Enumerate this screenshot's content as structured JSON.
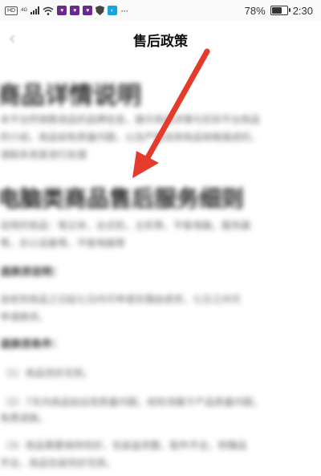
{
  "status_bar": {
    "hd_label": "HD",
    "network": "4G",
    "battery_percent": "78%",
    "battery_level": 0.78,
    "time": "2:30",
    "icons": [
      "signal-icon",
      "wifi-icon",
      "app-notification-icon",
      "app-notification-icon",
      "app-notification-icon",
      "shield-icon",
      "message-icon",
      "more-icon",
      "battery-icon"
    ]
  },
  "header": {
    "title": "售后政策",
    "back_label": "‹"
  },
  "content": {
    "heading_main": "商品详情说明",
    "heading_main_para": [
      "本平台所销售商品的品牌信息，展示商品详情与实际平台商品",
      "的介绍，商品如有质量问题，以及严重违背商品规格描述的，",
      "请联系商家进行处理"
    ],
    "heading_section": "电脑类商品售后服务细则",
    "section_para": [
      "适用的商品：笔记本，台式机，主机等，平板电脑，服务器",
      "等，办公设备等，平板电脑等"
    ],
    "subheading_1": "退换货说明：",
    "sub1_para": [
      "自收到商品之日起七日内可申请无理由退货，七日之内可",
      "申请换货。"
    ],
    "subheading_2": "退换货条件：",
    "list_items": [
      "（1）商品完好无损。",
      "（2）7天内商品如出现质量问题，经检测属于产品质量问题，",
      "      免费退换。",
      "（3）商品需要保持完好，包装盒完整，配件齐全，附赠品",
      "      齐全，商品包装完好无损。"
    ]
  },
  "annotation": {
    "arrow_color": "#e53b2c"
  }
}
